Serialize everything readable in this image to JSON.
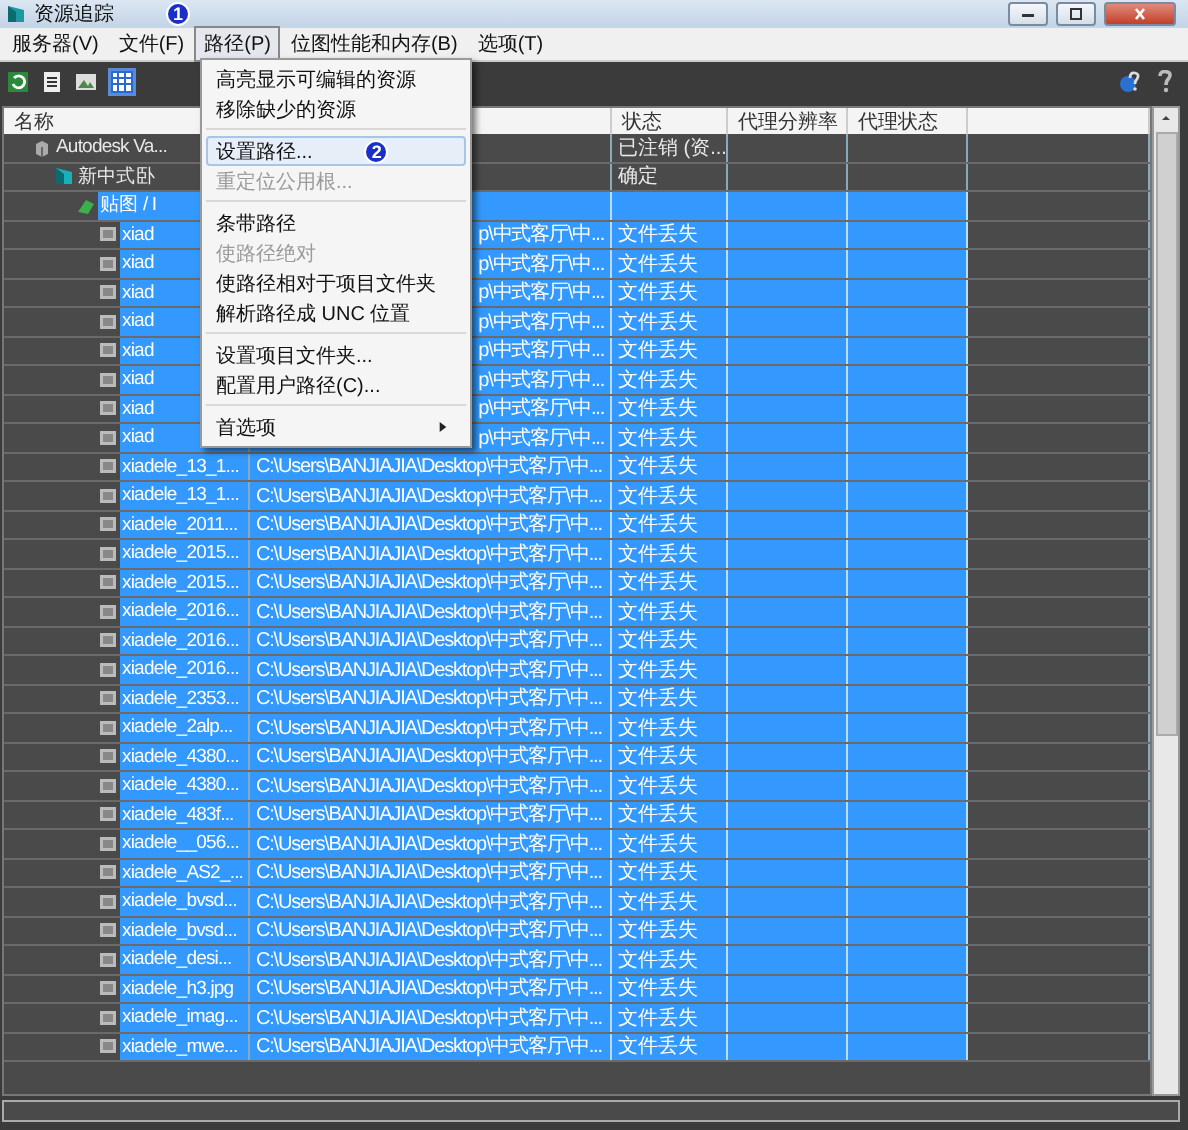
{
  "window": {
    "title": "资源追踪",
    "badge": "1"
  },
  "menu_bar": [
    {
      "label": "服务器(V)",
      "selected": false
    },
    {
      "label": "文件(F)",
      "selected": false
    },
    {
      "label": "路径(P)",
      "selected": true
    },
    {
      "label": "位图性能和内存(B)",
      "selected": false
    },
    {
      "label": "选项(T)",
      "selected": false
    }
  ],
  "path_menu": [
    {
      "kind": "item",
      "label": "高亮显示可编辑的资源",
      "disabled": false,
      "selected": false
    },
    {
      "kind": "item",
      "label": "移除缺少的资源",
      "disabled": false,
      "selected": false
    },
    {
      "kind": "separator"
    },
    {
      "kind": "item",
      "label": "设置路径...",
      "disabled": false,
      "selected": true,
      "badge": "2"
    },
    {
      "kind": "item",
      "label": "重定位公用根...",
      "disabled": true,
      "selected": false
    },
    {
      "kind": "separator"
    },
    {
      "kind": "item",
      "label": "条带路径",
      "disabled": false,
      "selected": false
    },
    {
      "kind": "item",
      "label": "使路径绝对",
      "disabled": true,
      "selected": false
    },
    {
      "kind": "item",
      "label": "使路径相对于项目文件夹",
      "disabled": false,
      "selected": false
    },
    {
      "kind": "item",
      "label": "解析路径成 UNC 位置",
      "disabled": false,
      "selected": false
    },
    {
      "kind": "separator"
    },
    {
      "kind": "item",
      "label": "设置项目文件夹...",
      "disabled": false,
      "selected": false
    },
    {
      "kind": "item",
      "label": "配置用户路径(C)...",
      "disabled": false,
      "selected": false
    },
    {
      "kind": "separator"
    },
    {
      "kind": "submenu",
      "label": "首选项",
      "disabled": false,
      "selected": false
    }
  ],
  "table": {
    "columns": [
      "名称",
      "状态",
      "代理分辨率",
      "代理状态"
    ],
    "rows": [
      {
        "kind": "server",
        "name": "Autodesk Va...",
        "status": "已注销 (资...",
        "selected": false,
        "children": [
          {
            "kind": "scene",
            "name": "新中式卧",
            "status": "确定",
            "selected": false,
            "children": [
              {
                "kind": "folder",
                "name": "贴图 / I",
                "selected": true,
                "children": [
                  {
                    "kind": "file",
                    "name": "xiad",
                    "path": "p\\中式客厅\\中...",
                    "partial": true,
                    "status": "文件丢失",
                    "selected": true
                  },
                  {
                    "kind": "file",
                    "name": "xiad",
                    "path": "p\\中式客厅\\中...",
                    "partial": true,
                    "status": "文件丢失",
                    "selected": true
                  },
                  {
                    "kind": "file",
                    "name": "xiad",
                    "path": "p\\中式客厅\\中...",
                    "partial": true,
                    "status": "文件丢失",
                    "selected": true
                  },
                  {
                    "kind": "file",
                    "name": "xiad",
                    "path": "p\\中式客厅\\中...",
                    "partial": true,
                    "status": "文件丢失",
                    "selected": true
                  },
                  {
                    "kind": "file",
                    "name": "xiad",
                    "path": "p\\中式客厅\\中...",
                    "partial": true,
                    "status": "文件丢失",
                    "selected": true
                  },
                  {
                    "kind": "file",
                    "name": "xiad",
                    "path": "p\\中式客厅\\中...",
                    "partial": true,
                    "status": "文件丢失",
                    "selected": true
                  },
                  {
                    "kind": "file",
                    "name": "xiad",
                    "path": "p\\中式客厅\\中...",
                    "partial": true,
                    "status": "文件丢失",
                    "selected": true
                  },
                  {
                    "kind": "file",
                    "name": "xiad",
                    "path": "p\\中式客厅\\中...",
                    "partial": true,
                    "status": "文件丢失",
                    "selected": true
                  },
                  {
                    "kind": "file",
                    "name": "xiadele_13_1...",
                    "path": "C:\\Users\\BANJIAJIA\\Desktop\\中式客厅\\中...",
                    "status": "文件丢失",
                    "selected": true
                  },
                  {
                    "kind": "file",
                    "name": "xiadele_13_1...",
                    "path": "C:\\Users\\BANJIAJIA\\Desktop\\中式客厅\\中...",
                    "status": "文件丢失",
                    "selected": true
                  },
                  {
                    "kind": "file",
                    "name": "xiadele_2011...",
                    "path": "C:\\Users\\BANJIAJIA\\Desktop\\中式客厅\\中...",
                    "status": "文件丢失",
                    "selected": true
                  },
                  {
                    "kind": "file",
                    "name": "xiadele_2015...",
                    "path": "C:\\Users\\BANJIAJIA\\Desktop\\中式客厅\\中...",
                    "status": "文件丢失",
                    "selected": true
                  },
                  {
                    "kind": "file",
                    "name": "xiadele_2015...",
                    "path": "C:\\Users\\BANJIAJIA\\Desktop\\中式客厅\\中...",
                    "status": "文件丢失",
                    "selected": true
                  },
                  {
                    "kind": "file",
                    "name": "xiadele_2016...",
                    "path": "C:\\Users\\BANJIAJIA\\Desktop\\中式客厅\\中...",
                    "status": "文件丢失",
                    "selected": true
                  },
                  {
                    "kind": "file",
                    "name": "xiadele_2016...",
                    "path": "C:\\Users\\BANJIAJIA\\Desktop\\中式客厅\\中...",
                    "status": "文件丢失",
                    "selected": true
                  },
                  {
                    "kind": "file",
                    "name": "xiadele_2016...",
                    "path": "C:\\Users\\BANJIAJIA\\Desktop\\中式客厅\\中...",
                    "status": "文件丢失",
                    "selected": true
                  },
                  {
                    "kind": "file",
                    "name": "xiadele_2353...",
                    "path": "C:\\Users\\BANJIAJIA\\Desktop\\中式客厅\\中...",
                    "status": "文件丢失",
                    "selected": true
                  },
                  {
                    "kind": "file",
                    "name": "xiadele_2alp...",
                    "path": "C:\\Users\\BANJIAJIA\\Desktop\\中式客厅\\中...",
                    "status": "文件丢失",
                    "selected": true
                  },
                  {
                    "kind": "file",
                    "name": "xiadele_4380...",
                    "path": "C:\\Users\\BANJIAJIA\\Desktop\\中式客厅\\中...",
                    "status": "文件丢失",
                    "selected": true
                  },
                  {
                    "kind": "file",
                    "name": "xiadele_4380...",
                    "path": "C:\\Users\\BANJIAJIA\\Desktop\\中式客厅\\中...",
                    "status": "文件丢失",
                    "selected": true
                  },
                  {
                    "kind": "file",
                    "name": "xiadele_483f...",
                    "path": "C:\\Users\\BANJIAJIA\\Desktop\\中式客厅\\中...",
                    "status": "文件丢失",
                    "selected": true
                  },
                  {
                    "kind": "file",
                    "name": "xiadele__056...",
                    "path": "C:\\Users\\BANJIAJIA\\Desktop\\中式客厅\\中...",
                    "status": "文件丢失",
                    "selected": true
                  },
                  {
                    "kind": "file",
                    "name": "xiadele_AS2_...",
                    "path": "C:\\Users\\BANJIAJIA\\Desktop\\中式客厅\\中...",
                    "status": "文件丢失",
                    "selected": true
                  },
                  {
                    "kind": "file",
                    "name": "xiadele_bvsd...",
                    "path": "C:\\Users\\BANJIAJIA\\Desktop\\中式客厅\\中...",
                    "status": "文件丢失",
                    "selected": true
                  },
                  {
                    "kind": "file",
                    "name": "xiadele_bvsd...",
                    "path": "C:\\Users\\BANJIAJIA\\Desktop\\中式客厅\\中...",
                    "status": "文件丢失",
                    "selected": true
                  },
                  {
                    "kind": "file",
                    "name": "xiadele_desi...",
                    "path": "C:\\Users\\BANJIAJIA\\Desktop\\中式客厅\\中...",
                    "status": "文件丢失",
                    "selected": true
                  },
                  {
                    "kind": "file",
                    "name": "xiadele_h3.jpg",
                    "path": "C:\\Users\\BANJIAJIA\\Desktop\\中式客厅\\中...",
                    "status": "文件丢失",
                    "selected": true
                  },
                  {
                    "kind": "file",
                    "name": "xiadele_imag...",
                    "path": "C:\\Users\\BANJIAJIA\\Desktop\\中式客厅\\中...",
                    "status": "文件丢失",
                    "selected": true
                  },
                  {
                    "kind": "file",
                    "name": "xiadele_mwe...",
                    "path": "C:\\Users\\BANJIAJIA\\Desktop\\中式客厅\\中...",
                    "status": "文件丢失",
                    "selected": true
                  }
                ]
              }
            ]
          }
        ]
      }
    ]
  }
}
